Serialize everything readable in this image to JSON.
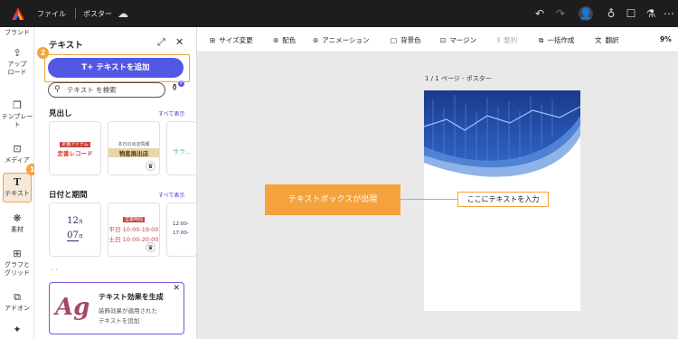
{
  "topbar": {
    "file_menu": "ファイル",
    "doc_name": "ポスター",
    "zoom": "9%"
  },
  "rail": {
    "items": [
      {
        "label": "ブランド"
      },
      {
        "label": "アップ\nロード"
      },
      {
        "label": "テンプレー\nト"
      },
      {
        "label": "メディア"
      },
      {
        "label": "テキスト"
      },
      {
        "label": "素材"
      },
      {
        "label": "グラフと\nグリッド"
      },
      {
        "label": "アドオン"
      }
    ]
  },
  "panel": {
    "title": "テキスト",
    "add_text_button": "テキストを追加",
    "search_placeholder": "テキスト を検索",
    "filter_count": "2",
    "section_headings": "見出し",
    "section_dates": "日付と期間",
    "see_all": "すべて表示",
    "heading_cards": [
      {
        "tag": "定番アイテム",
        "main": "定番レコード"
      },
      {
        "tag": "本日の出店情報",
        "main": "物産展出店"
      },
      {
        "tag": "",
        "main": "サラ..."
      }
    ],
    "date_cards": [
      {
        "top": "12",
        "mid": "07",
        "unit": "月",
        "day": "日"
      },
      {
        "tag": "営業時間",
        "l1": "平日 10:00-19:00",
        "l2": "土日 10:00-20:00"
      },
      {
        "l1": "12:00-",
        "l2": "17:00-"
      }
    ],
    "promo": {
      "glyph": "Ag",
      "title": "テキスト効果を生成",
      "line1": "装飾効果が適用された",
      "line2": "テキストを追加"
    }
  },
  "badges": {
    "one": "1",
    "two": "2"
  },
  "toolbar": {
    "resize": "サイズ変更",
    "colors": "配色",
    "animation": "アニメーション",
    "background": "背景色",
    "margin": "マージン",
    "align": "整列",
    "bulk": "一括作成",
    "translate": "翻訳"
  },
  "canvas": {
    "page_label": "1 / 1 ページ - ポスター",
    "text_box": "ここにテキストを入力",
    "callout": "テキストボックスが出現"
  },
  "colors": {
    "accent": "#5258e4",
    "highlight": "#f4a23c",
    "topbar": "#1d1d1d"
  }
}
